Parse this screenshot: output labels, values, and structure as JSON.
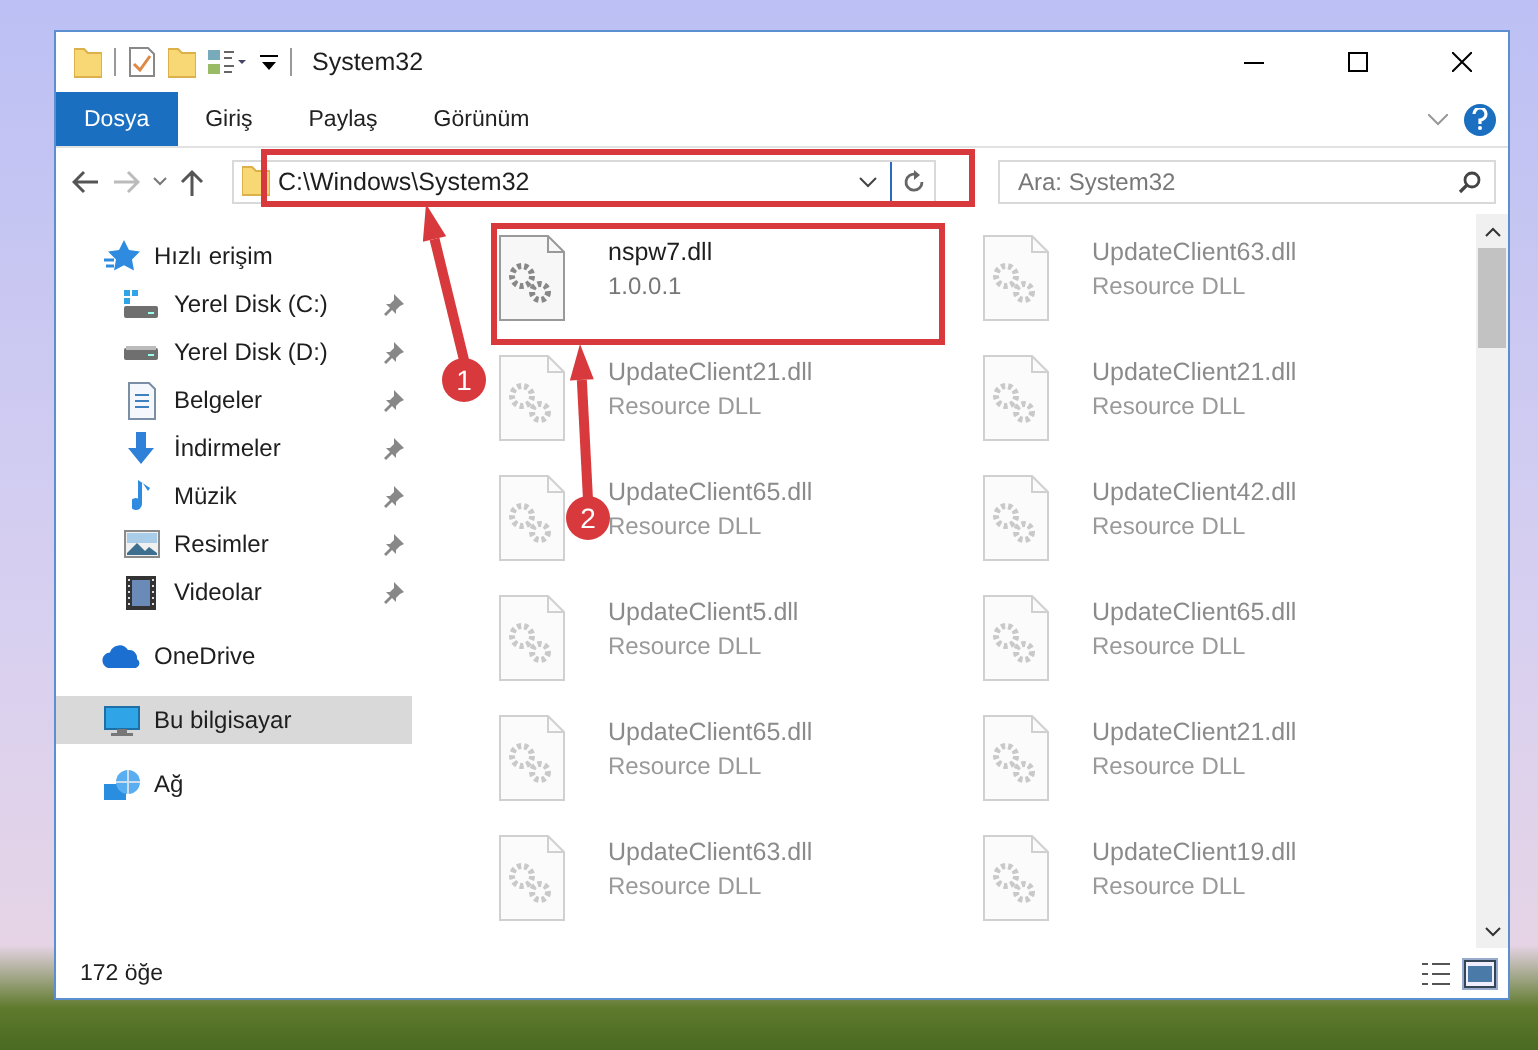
{
  "window": {
    "title": "System32"
  },
  "ribbon_tabs": [
    {
      "label": "Dosya",
      "selected": true
    },
    {
      "label": "Giriş",
      "selected": false
    },
    {
      "label": "Paylaş",
      "selected": false
    },
    {
      "label": "Görünüm",
      "selected": false
    }
  ],
  "address_bar": {
    "path": "C:\\Windows\\System32"
  },
  "search": {
    "placeholder": "Ara: System32"
  },
  "sidebar": {
    "items": [
      {
        "label": "Hızlı erişim",
        "kind": "star",
        "selected": false,
        "children": [
          {
            "label": "Yerel Disk (C:)",
            "kind": "system-drive",
            "pinned": true,
            "selected": false
          },
          {
            "label": "Yerel Disk (D:)",
            "kind": "drive",
            "pinned": true,
            "selected": false
          },
          {
            "label": "Belgeler",
            "kind": "documents",
            "pinned": true,
            "selected": false
          },
          {
            "label": "İndirmeler",
            "kind": "downloads",
            "pinned": true,
            "selected": false
          },
          {
            "label": "Müzik",
            "kind": "music",
            "pinned": true,
            "selected": false
          },
          {
            "label": "Resimler",
            "kind": "pictures",
            "pinned": true,
            "selected": false
          },
          {
            "label": "Videolar",
            "kind": "videos",
            "pinned": true,
            "selected": false
          }
        ]
      },
      {
        "label": "OneDrive",
        "kind": "cloud",
        "selected": false
      },
      {
        "label": "Bu bilgisayar",
        "kind": "computer",
        "selected": true
      },
      {
        "label": "Ağ",
        "kind": "network",
        "selected": false
      }
    ]
  },
  "files": [
    {
      "name": "nspw7.dll",
      "detail": "1.0.0.1",
      "dimmed": false
    },
    {
      "name": "UpdateClient63.dll",
      "detail": "Resource DLL",
      "dimmed": true
    },
    {
      "name": "UpdateClient21.dll",
      "detail": "Resource DLL",
      "dimmed": true
    },
    {
      "name": "UpdateClient21.dll",
      "detail": "Resource DLL",
      "dimmed": true
    },
    {
      "name": "UpdateClient65.dll",
      "detail": "Resource DLL",
      "dimmed": true
    },
    {
      "name": "UpdateClient42.dll",
      "detail": "Resource DLL",
      "dimmed": true
    },
    {
      "name": "UpdateClient5.dll",
      "detail": "Resource DLL",
      "dimmed": true
    },
    {
      "name": "UpdateClient65.dll",
      "detail": "Resource DLL",
      "dimmed": true
    },
    {
      "name": "UpdateClient65.dll",
      "detail": "Resource DLL",
      "dimmed": true
    },
    {
      "name": "UpdateClient21.dll",
      "detail": "Resource DLL",
      "dimmed": true
    },
    {
      "name": "UpdateClient63.dll",
      "detail": "Resource DLL",
      "dimmed": true
    },
    {
      "name": "UpdateClient19.dll",
      "detail": "Resource DLL",
      "dimmed": true
    }
  ],
  "status_bar": {
    "item_count": "172 öğe"
  },
  "annotations": [
    {
      "number": "1"
    },
    {
      "number": "2"
    }
  ]
}
